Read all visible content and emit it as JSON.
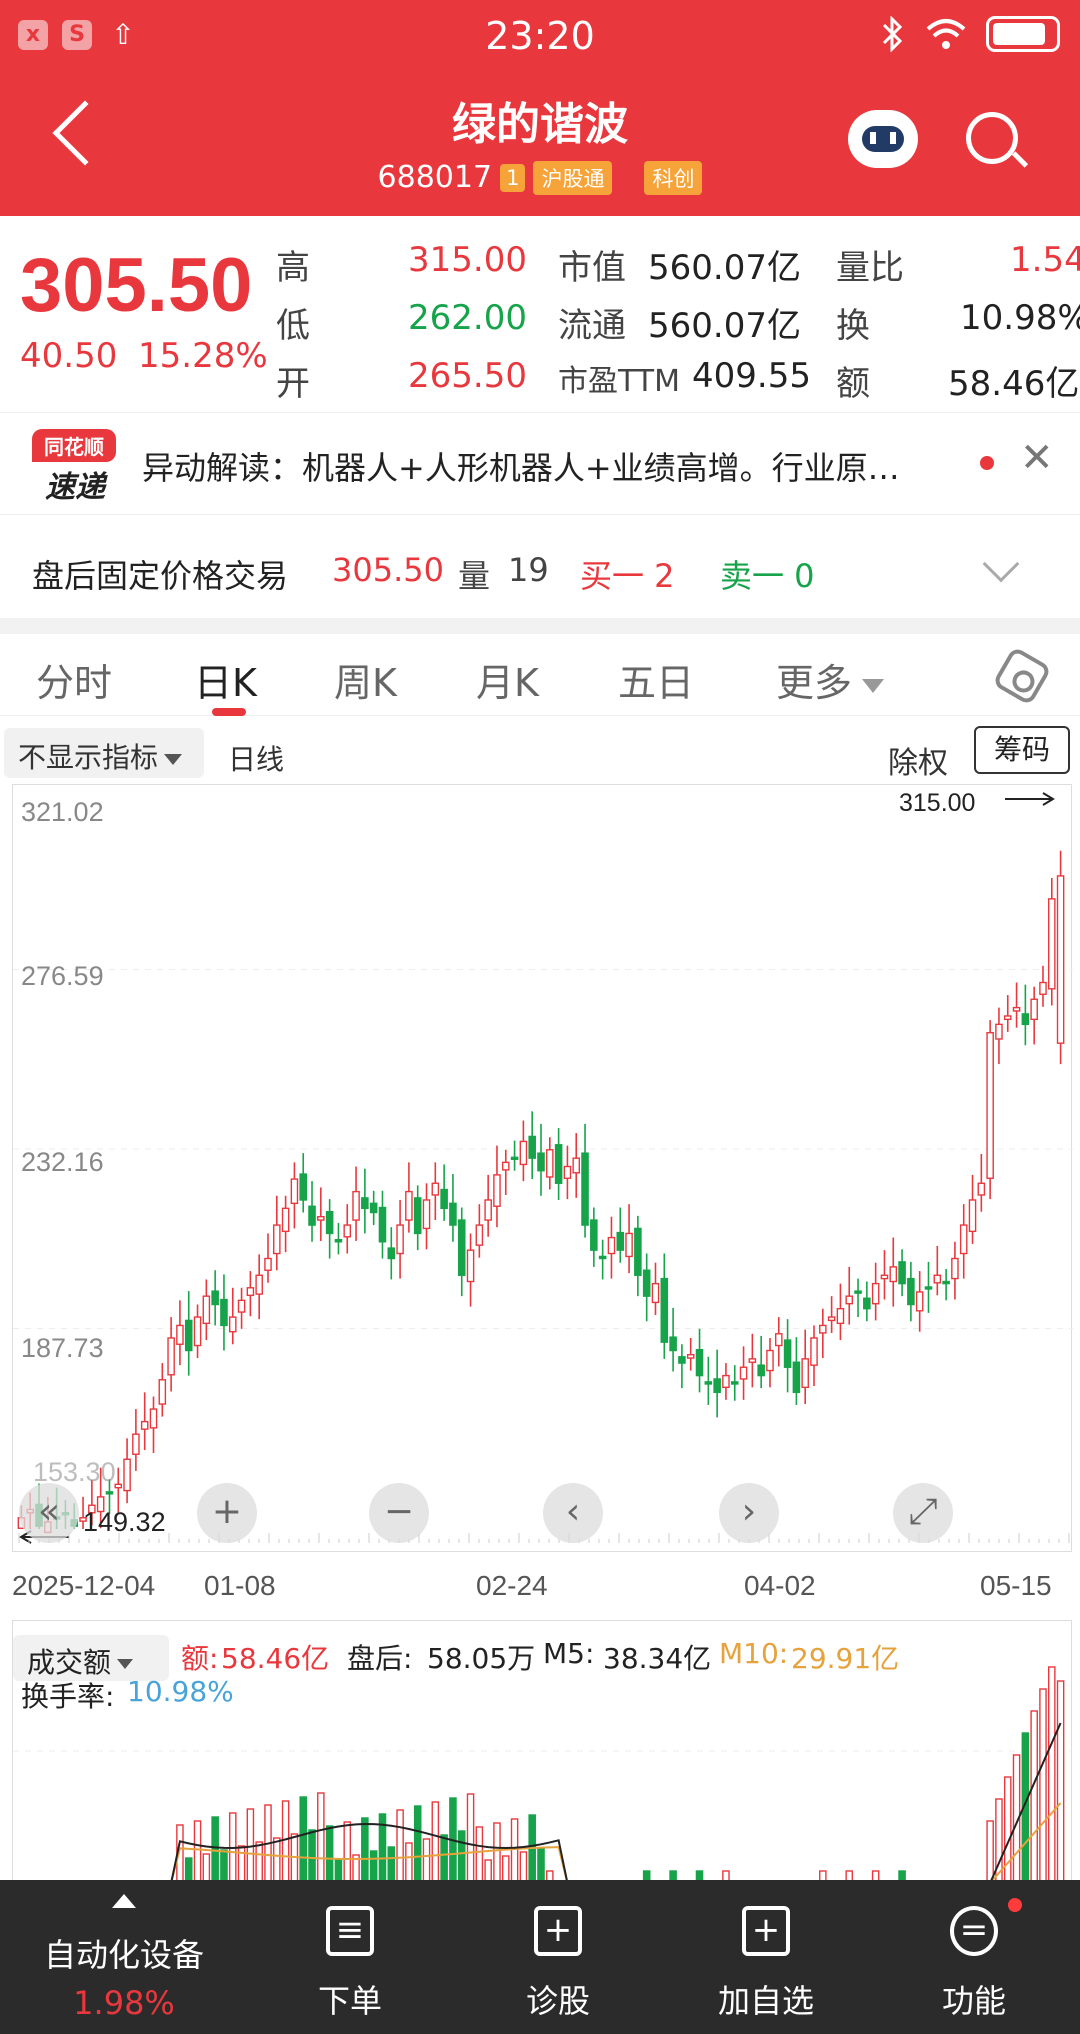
{
  "status_bar": {
    "time": "23:20",
    "icon_left_1": "x",
    "icon_left_2": "S",
    "icon_left_3": "⇧"
  },
  "header": {
    "title": "绿的谐波",
    "code": "688017",
    "tag_1": "1",
    "tag_hgt": "沪股通",
    "tag_kc": "科创"
  },
  "quote": {
    "price": "305.50",
    "change": "40.50",
    "change_pct": "15.28%",
    "high_label": "高",
    "high": "315.00",
    "low_label": "低",
    "low": "262.00",
    "open_label": "开",
    "open": "265.50",
    "mcap_label": "市值",
    "mcap": "560.07亿",
    "float_label": "流通",
    "float": "560.07亿",
    "pe_label": "市盈TTM",
    "pe": "409.55",
    "vr_label": "量比",
    "vr": "1.54",
    "turnover_label": "换",
    "turnover": "10.98%",
    "amount_label": "额",
    "amount": "58.46亿"
  },
  "news": {
    "logo_top": "同花顺",
    "logo_bottom": "速递",
    "text": "异动解读：机器人+人形机器人+业绩高增。行业原…"
  },
  "after_trade": {
    "label": "盘后固定价格交易",
    "price": "305.50",
    "vol_label": "量",
    "vol": "19",
    "buy": "买一 2",
    "sell": "卖一 0"
  },
  "tabs": [
    {
      "label": "分时"
    },
    {
      "label": "日K"
    },
    {
      "label": "周K"
    },
    {
      "label": "月K"
    },
    {
      "label": "五日"
    },
    {
      "label": "更多"
    }
  ],
  "kbar": {
    "indicator": "不显示指标",
    "period": "日线",
    "fq": "除权",
    "chip": "筹码"
  },
  "chart_data": {
    "type": "candlestick",
    "y_ticks": [
      "321.02",
      "276.59",
      "232.16",
      "187.73"
    ],
    "ylim": [
      149.32,
      321.02
    ],
    "x_ticks": [
      "2025-12-04",
      "01-08",
      "02-24",
      "04-02",
      "05-15"
    ],
    "max_label": "315.00",
    "min_label": "149.32",
    "current_start_label": "153.30",
    "closes": [
      152,
      154,
      150,
      151,
      152,
      153,
      150,
      152,
      155,
      157,
      158,
      160,
      166,
      172,
      175,
      178,
      185,
      195,
      198,
      192,
      200,
      205,
      203,
      198,
      200,
      204,
      207,
      210,
      214,
      222,
      226,
      233,
      228,
      222,
      224,
      220,
      218,
      222,
      230,
      226,
      225,
      218,
      214,
      222,
      230,
      220,
      228,
      232,
      226,
      222,
      210,
      216,
      222,
      228,
      234,
      237,
      238,
      242,
      238,
      235,
      240,
      232,
      236,
      238,
      222,
      216,
      214,
      219,
      216,
      220,
      210,
      205,
      208,
      194,
      192,
      189,
      191,
      186,
      184,
      182,
      186,
      184,
      188,
      190,
      186,
      192,
      196,
      188,
      182,
      190,
      195,
      198,
      200,
      202,
      205,
      206,
      202,
      208,
      210,
      212,
      208,
      203,
      206,
      207,
      210,
      208,
      214,
      222,
      228,
      232,
      268,
      270,
      272,
      274,
      270,
      276,
      280,
      300,
      305.5
    ],
    "volume": {
      "amount_label": "额:",
      "amount": "58.46亿",
      "after_label": "盘后:",
      "after": "58.05万",
      "m5_label": "M5:",
      "m5": "38.34亿",
      "m10_label": "M10:",
      "m10": "29.91亿",
      "turnover_label": "换手率:",
      "turnover": "10.98%",
      "title": "成交额"
    }
  },
  "bottom_nav": {
    "sector_name": "自动化设备",
    "sector_pct": "1.98%",
    "items": [
      {
        "label": "下单",
        "icon": "document-icon"
      },
      {
        "label": "诊股",
        "icon": "diagnose-icon"
      },
      {
        "label": "加自选",
        "icon": "add-watchlist-icon"
      },
      {
        "label": "功能",
        "icon": "menu-icon"
      }
    ]
  },
  "colors": {
    "up": "#e8383d",
    "down": "#16a34a",
    "header": "#e8383d",
    "m10": "#e6a23c"
  }
}
